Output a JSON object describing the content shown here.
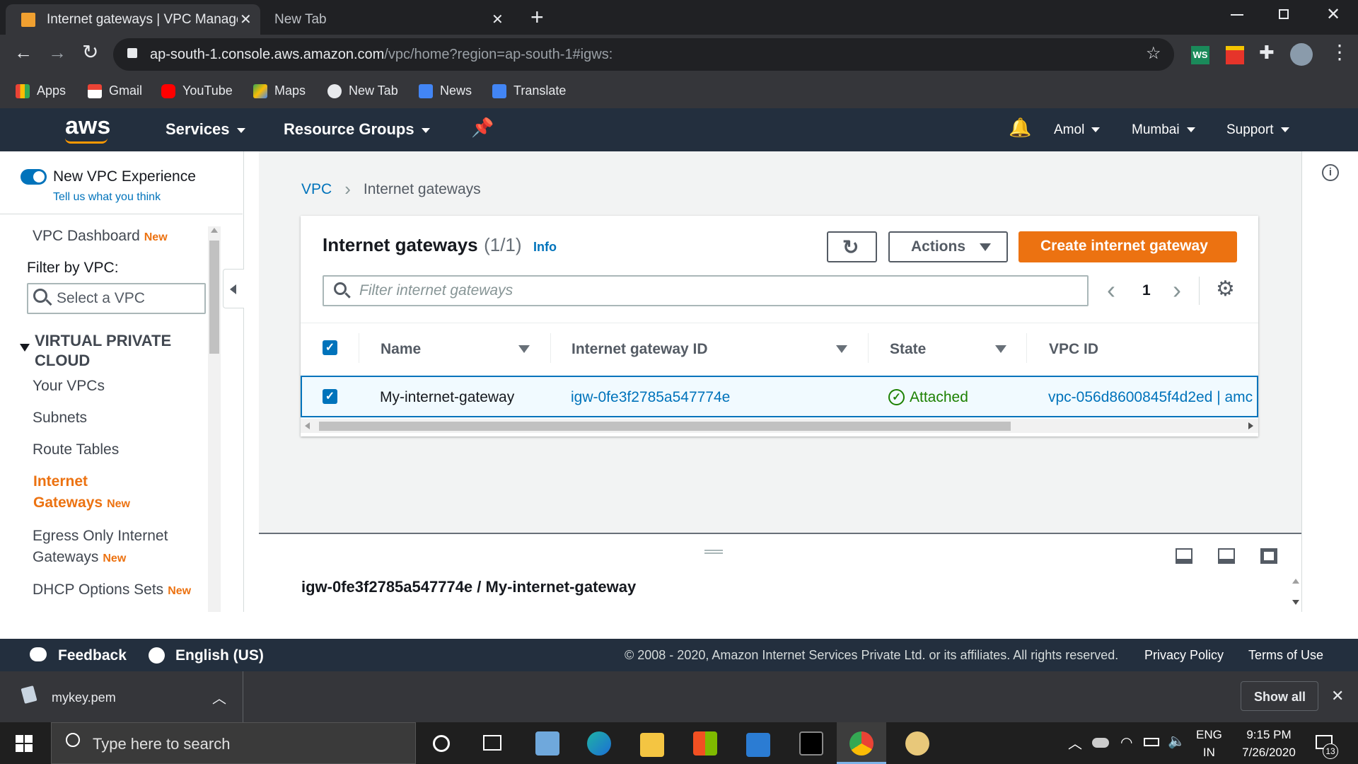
{
  "browser": {
    "tabs": [
      {
        "title": "Internet gateways | VPC Manager",
        "active": true
      },
      {
        "title": "New Tab",
        "active": false
      }
    ],
    "url_host": "ap-south-1.console.aws.amazon.com",
    "url_path": "/vpc/home?region=ap-south-1#igws:",
    "bookmarks": [
      "Apps",
      "Gmail",
      "YouTube",
      "Maps",
      "New Tab",
      "News",
      "Translate"
    ],
    "extensions": {
      "ws_label": "WS"
    }
  },
  "aws_nav": {
    "logo": "aws",
    "services": "Services",
    "resource_groups": "Resource Groups",
    "user": "Amol",
    "region": "Mumbai",
    "support": "Support"
  },
  "sidebar": {
    "toggle_label": "New VPC Experience",
    "feedback_link": "Tell us what you think",
    "dashboard": "VPC Dashboard",
    "new_tag": "New",
    "filter_label": "Filter by VPC:",
    "filter_placeholder": "Select a VPC",
    "section_title_1": "VIRTUAL PRIVATE",
    "section_title_2": "CLOUD",
    "items": [
      {
        "label": "Your VPCs"
      },
      {
        "label": "Subnets"
      },
      {
        "label": "Route Tables"
      },
      {
        "label1": "Internet",
        "label2": "Gateways",
        "active": true
      },
      {
        "label1": "Egress Only Internet",
        "label2": "Gateways"
      },
      {
        "label": "DHCP Options Sets"
      }
    ]
  },
  "breadcrumb": {
    "root": "VPC",
    "current": "Internet gateways"
  },
  "panel": {
    "title": "Internet gateways",
    "count": "(1/1)",
    "info": "Info",
    "actions": "Actions",
    "create": "Create internet gateway",
    "search_placeholder": "Filter internet gateways",
    "page": "1",
    "columns": [
      "Name",
      "Internet gateway ID",
      "State",
      "VPC ID"
    ],
    "rows": [
      {
        "name": "My-internet-gateway",
        "id": "igw-0fe3f2785a547774e",
        "state": "Attached",
        "vpc": "vpc-056d8600845f4d2ed | amc"
      }
    ]
  },
  "split_panel": {
    "title": "igw-0fe3f2785a547774e / My-internet-gateway"
  },
  "footer": {
    "feedback": "Feedback",
    "language": "English (US)",
    "copyright": "© 2008 - 2020, Amazon Internet Services Private Ltd. or its affiliates. All rights reserved.",
    "privacy": "Privacy Policy",
    "terms": "Terms of Use"
  },
  "downloads": {
    "file": "mykey.pem",
    "show_all": "Show all"
  },
  "taskbar": {
    "search_placeholder": "Type here to search",
    "lang1": "ENG",
    "lang2": "IN",
    "time": "9:15 PM",
    "date": "7/26/2020",
    "notifications": "13"
  },
  "colors": {
    "aws_orange": "#ec7211",
    "aws_navy": "#232f3e",
    "link_blue": "#0073bb",
    "success_green": "#1d8102"
  }
}
